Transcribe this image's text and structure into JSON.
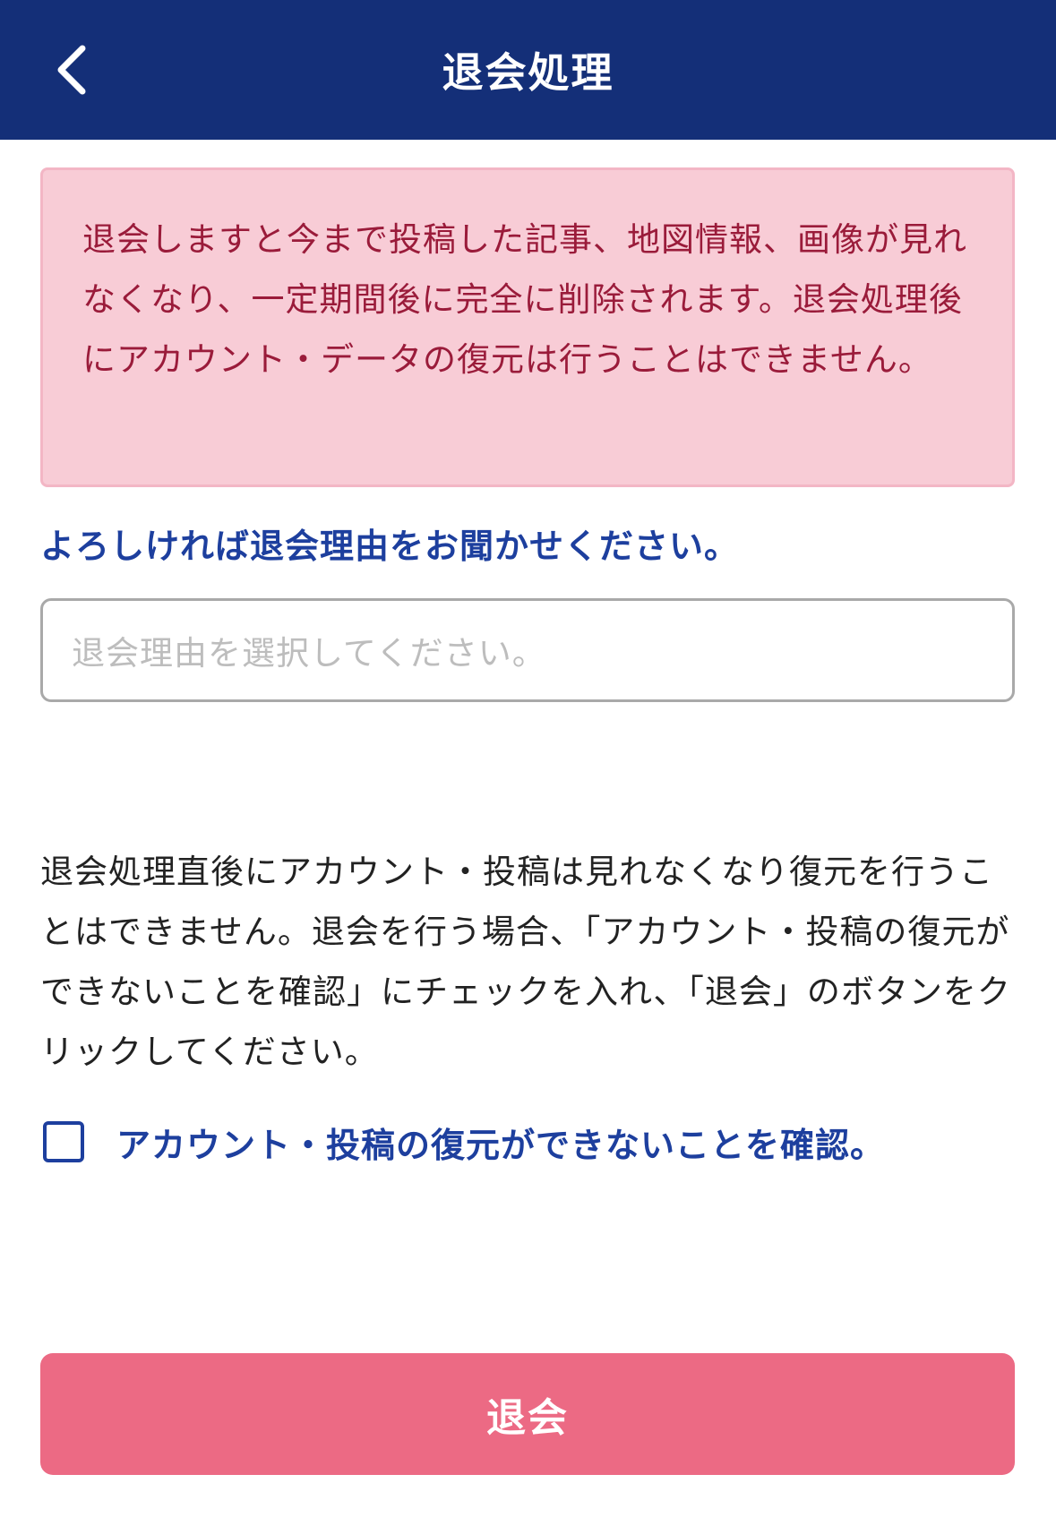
{
  "header": {
    "title": "退会処理",
    "background": "#142f78"
  },
  "warning": {
    "text": "退会しますと今まで投稿した記事、地図情報、画像が見れなくなり、一定期間後に完全に削除されます。退会処理後にアカウント・データの復元は行うことはできません。",
    "background": "#f8ccd6",
    "text_color": "#9a1b3a"
  },
  "reason": {
    "label": "よろしければ退会理由をお聞かせください。",
    "placeholder": "退会理由を選択してください。"
  },
  "instructions": {
    "text": "退会処理直後にアカウント・投稿は見れなくなり復元を行うことはできません。退会を行う場合、「アカウント・投稿の復元ができないことを確認」にチェックを入れ、「退会」のボタンをクリックしてください。"
  },
  "confirm": {
    "label": "アカウント・投稿の復元ができないことを確認。",
    "checked": false
  },
  "withdraw_button": {
    "label": "退会",
    "color": "#ec6a84"
  },
  "icons": {
    "back": "chevron-left-icon",
    "checkbox": "checkbox-unchecked-icon"
  }
}
